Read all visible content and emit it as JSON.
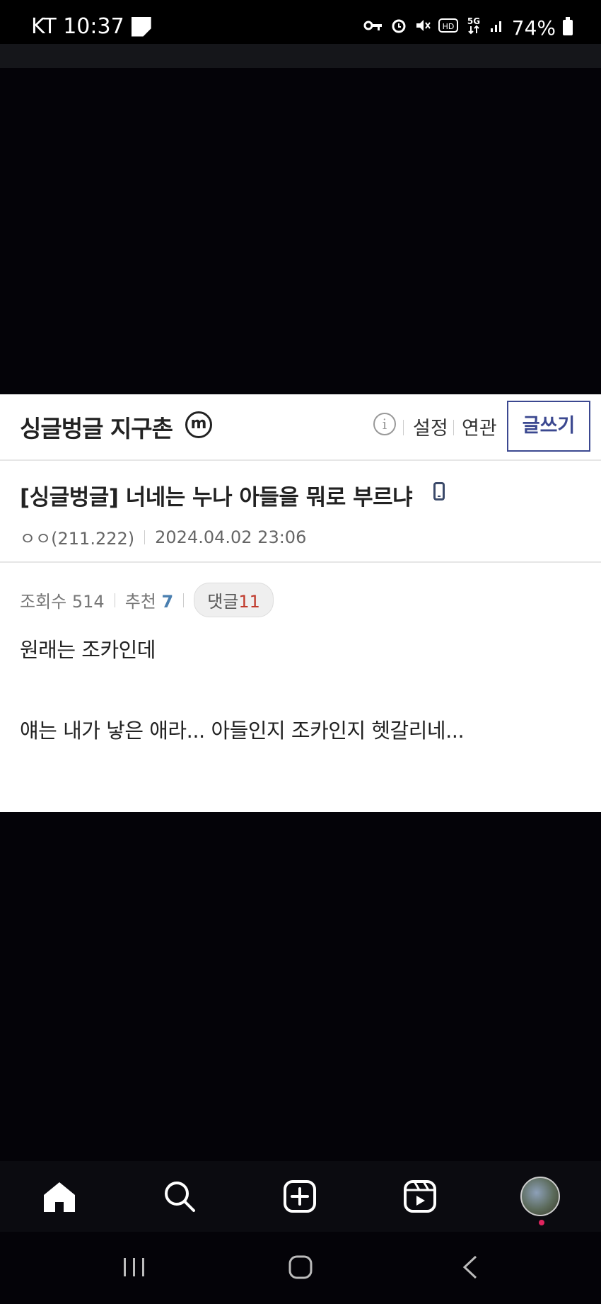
{
  "status_bar": {
    "carrier_time": "KT 10:37",
    "battery": "74%",
    "icons": [
      "key-icon",
      "alarm-icon",
      "mute-icon",
      "hd-icon",
      "5g-icon",
      "signal-icon",
      "battery-icon"
    ]
  },
  "gallery": {
    "title": "싱글벙글 지구촌",
    "badge": "m",
    "info_label": "i",
    "settings_label": "설정",
    "related_label": "연관",
    "write_button": "글쓰기"
  },
  "post": {
    "title": "[싱글벙글] 너네는 누나 아들을 뭐로 부르냐",
    "author": "ㅇㅇ(211.222)",
    "datetime": "2024.04.02 23:06",
    "views_label": "조회수",
    "views": "514",
    "recommend_label": "추천",
    "recommend": "7",
    "comments_label": "댓글",
    "comments": "11",
    "body": [
      "원래는 조카인데",
      "얘는 내가 낳은 애라... 아들인지 조카인지 헷갈리네..."
    ]
  },
  "bottom_nav": {
    "items": [
      "home-icon",
      "search-icon",
      "create-icon",
      "reels-icon",
      "profile-avatar"
    ]
  },
  "system_nav": {
    "items": [
      "recent-apps-icon",
      "home-button-icon",
      "back-icon"
    ]
  },
  "colors": {
    "accent": "#3b4890",
    "recommend": "#4a7fb0",
    "comments": "#c0392b",
    "background": "#040308"
  }
}
